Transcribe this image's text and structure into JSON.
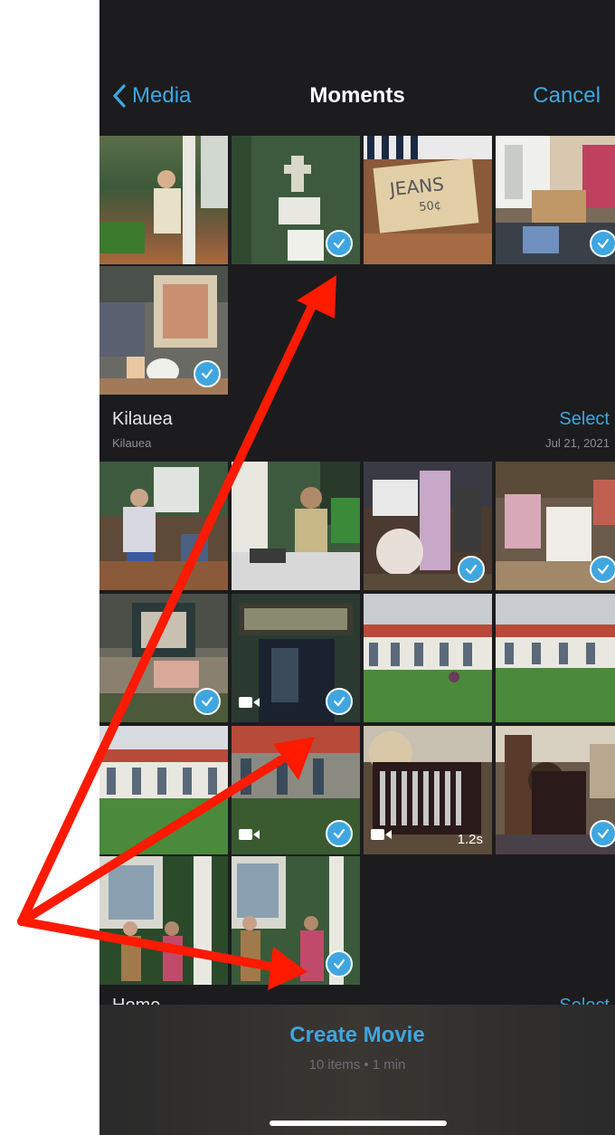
{
  "nav": {
    "back_label": "Media",
    "title": "Moments",
    "cancel_label": "Cancel"
  },
  "section_kilauea": {
    "title": "Kilauea",
    "subtitle": "Kilauea",
    "select_label": "Select",
    "date": "Jul 21, 2021"
  },
  "section_next": {
    "title": "Home",
    "select_label": "Select"
  },
  "bottom": {
    "create_label": "Create Movie",
    "summary": "10 items • 1 min"
  },
  "photos": {
    "top_row": [
      {
        "selected": false
      },
      {
        "selected": true
      },
      {
        "selected": false
      },
      {
        "selected": true
      },
      {
        "selected": true
      }
    ],
    "kilauea_grid": [
      {
        "selected": false
      },
      {
        "selected": false
      },
      {
        "selected": true
      },
      {
        "selected": true
      },
      {
        "selected": true
      },
      {
        "selected": true,
        "video": true
      },
      {
        "selected": false
      },
      {
        "selected": false
      },
      {
        "selected": false
      },
      {
        "selected": true,
        "video": true
      },
      {
        "selected": false,
        "video": true,
        "duration": "1.2s"
      },
      {
        "selected": true
      },
      {
        "selected": false
      },
      {
        "selected": true
      }
    ],
    "top_sign_text": "JEANS 50¢"
  },
  "colors": {
    "accent": "#3fa6e0",
    "background": "#1c1c1e",
    "arrow": "#ff1a00"
  }
}
